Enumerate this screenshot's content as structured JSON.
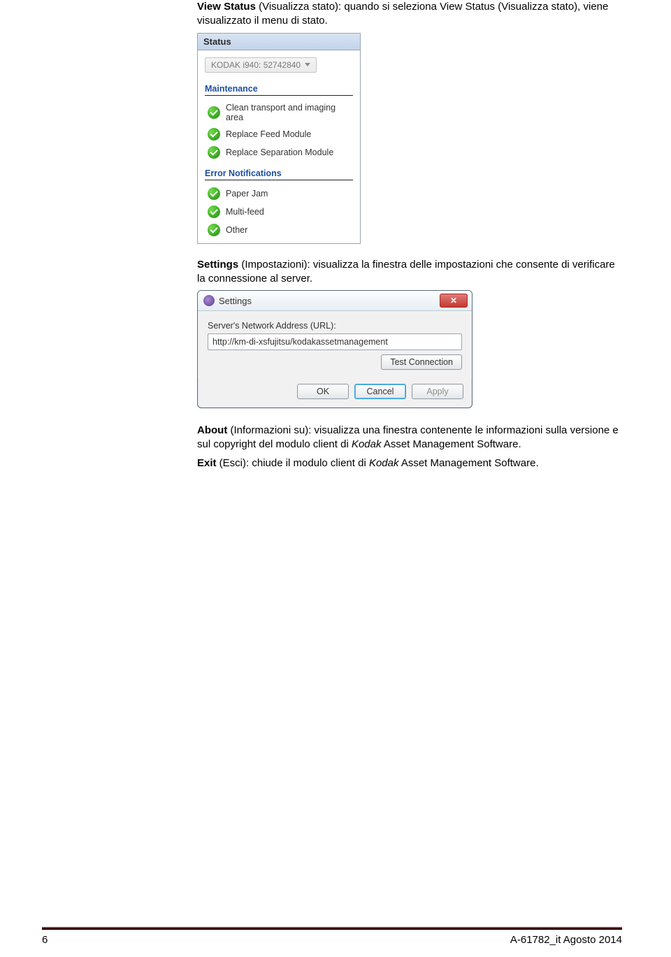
{
  "paragraphs": {
    "view_status_bold": "View Status",
    "view_status_rest": " (Visualizza stato): quando si seleziona View Status (Visualizza stato), viene visualizzato il menu di stato.",
    "settings_bold": "Settings",
    "settings_rest": " (Impostazioni): visualizza la finestra delle impostazioni che consente di verificare la connessione al server.",
    "about_bold": "About",
    "about_rest_1": " (Informazioni su): visualizza una finestra contenente le informazioni sulla versione e sul copyright del modulo client di ",
    "about_italic": "Kodak",
    "about_rest_2": " Asset Management Software.",
    "exit_bold": "Exit",
    "exit_rest_1": " (Esci): chiude il modulo client di ",
    "exit_italic": "Kodak",
    "exit_rest_2": " Asset Management Software."
  },
  "status_panel": {
    "title": "Status",
    "device": "KODAK i940: 52742840",
    "maintenance_label": "Maintenance",
    "maintenance_items": [
      "Clean transport and imaging area",
      "Replace Feed Module",
      "Replace Separation Module"
    ],
    "error_label": "Error Notifications",
    "error_items": [
      "Paper Jam",
      "Multi-feed",
      "Other"
    ]
  },
  "settings_dialog": {
    "title": "Settings",
    "label": "Server's Network Address (URL):",
    "url": "http://km-di-xsfujitsu/kodakassetmanagement",
    "test_btn": "Test Connection",
    "ok": "OK",
    "cancel": "Cancel",
    "apply": "Apply"
  },
  "footer": {
    "page_num": "6",
    "doc_id": "A-61782_it  Agosto 2014"
  }
}
